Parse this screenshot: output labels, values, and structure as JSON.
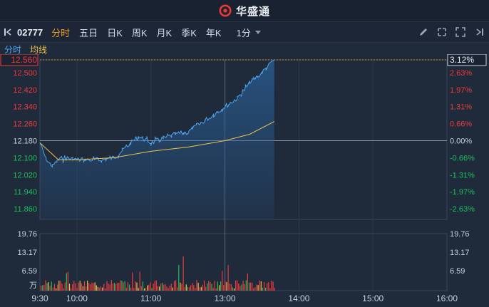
{
  "app": {
    "title": "华盛通"
  },
  "toolbar": {
    "code": "02777",
    "periods": [
      "分时",
      "五日",
      "日K",
      "周K",
      "月K",
      "季K",
      "年K"
    ],
    "active_period": "分时",
    "interval": "1分"
  },
  "legend": {
    "line1": "分时",
    "line2": "均线"
  },
  "colors": {
    "price_line": "#4fa6f0",
    "avg_line": "#f0c24a",
    "up": "#ef3b3b",
    "down": "#1fbf5c",
    "bg": "#1f2a3a"
  },
  "chart_data": {
    "type": "line",
    "price_axis": {
      "ticks": [
        "12.560",
        "12.500",
        "12.420",
        "12.340",
        "12.260",
        "12.180",
        "12.100",
        "12.020",
        "11.940",
        "11.860"
      ],
      "prev_close": "12.180",
      "current": "12.560"
    },
    "pct_axis": {
      "ticks": [
        "3.12%",
        "2.63%",
        "1.97%",
        "1.31%",
        "0.66%",
        "0.00%",
        "-0.66%",
        "-1.31%",
        "-1.97%",
        "-2.63%"
      ]
    },
    "volume_axis": {
      "ticks": [
        "19.76",
        "13.17",
        "6.59"
      ],
      "unit": "万"
    },
    "time_labels": [
      "9:30",
      "10:00",
      "11:00",
      "13:00",
      "14:00",
      "15:00",
      "16:00"
    ],
    "price_series": [
      [
        "9:30",
        12.17
      ],
      [
        "9:35",
        12.09
      ],
      [
        "9:40",
        12.06
      ],
      [
        "9:45",
        12.09
      ],
      [
        "9:50",
        12.1
      ],
      [
        "10:00",
        12.09
      ],
      [
        "10:10",
        12.09
      ],
      [
        "10:20",
        12.09
      ],
      [
        "10:30",
        12.1
      ],
      [
        "10:40",
        12.15
      ],
      [
        "10:50",
        12.2
      ],
      [
        "11:00",
        12.17
      ],
      [
        "11:10",
        12.19
      ],
      [
        "11:20",
        12.21
      ],
      [
        "11:30",
        12.22
      ],
      [
        "13:00",
        12.34
      ],
      [
        "13:10",
        12.38
      ],
      [
        "13:20",
        12.45
      ],
      [
        "13:30",
        12.5
      ],
      [
        "13:40",
        12.56
      ]
    ],
    "avg_series": [
      [
        "9:30",
        12.17
      ],
      [
        "9:45",
        12.09
      ],
      [
        "10:00",
        12.09
      ],
      [
        "10:30",
        12.1
      ],
      [
        "11:00",
        12.13
      ],
      [
        "11:30",
        12.15
      ],
      [
        "13:00",
        12.18
      ],
      [
        "13:20",
        12.21
      ],
      [
        "13:40",
        12.27
      ]
    ]
  }
}
